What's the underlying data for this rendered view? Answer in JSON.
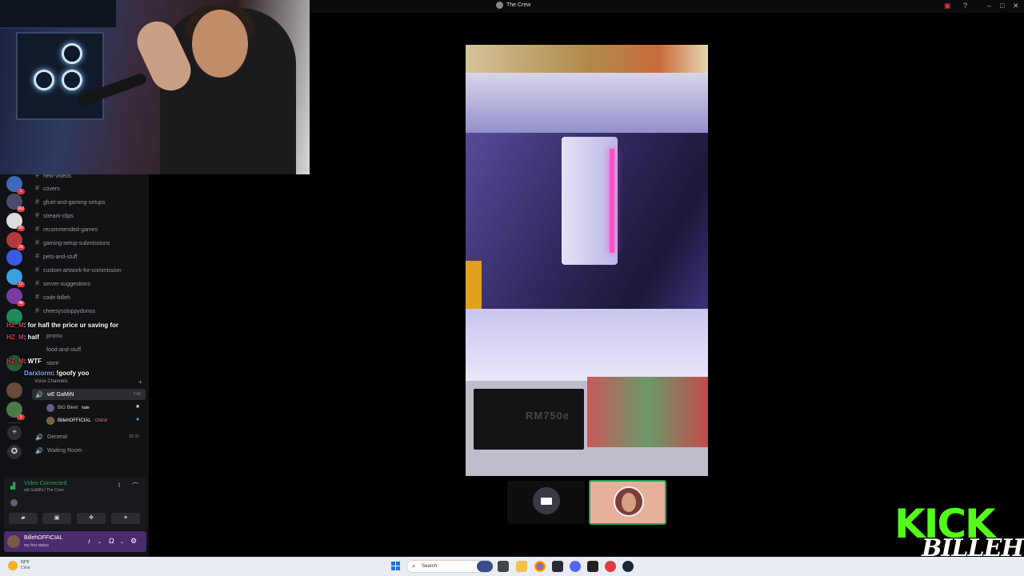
{
  "window": {
    "title": "The Crew"
  },
  "channels": [
    "new-videos",
    "covers",
    "gfuel-and-gaming-setups",
    "stream-clips",
    "recommended-games",
    "gaming-setup-submissions",
    "pets-and-stuff",
    "custom-artwork-for-commission",
    "server-suggestions",
    "code-billeh",
    "cheesyssloppydonos",
    "promo",
    "food-and-stuff",
    "store"
  ],
  "voice": {
    "header": "Voice Channels",
    "channels": [
      {
        "name": "wE GaMiN",
        "timer": "7:40"
      },
      {
        "name": "General",
        "count": "00",
        "limit": "25"
      },
      {
        "name": "Waiting Room"
      }
    ],
    "users": [
      {
        "name": "BiG Bleet",
        "tag": "kate"
      },
      {
        "name": "BillehOFFICIAL",
        "tag": "CREW"
      }
    ]
  },
  "connection": {
    "status": "Video Connected",
    "location": "wE GaMiN / The Crew"
  },
  "user_panel": {
    "name": "BillehOFFICIAL",
    "status": "my first status"
  },
  "server_badges": [
    "1",
    "162",
    "86",
    "28",
    "11",
    "1",
    "48",
    "1"
  ],
  "chat": [
    {
      "user": "HZ_M",
      "text": ": for hafl the price ur saving for"
    },
    {
      "user": "HZ_M",
      "text": ": half"
    },
    {
      "user": "HZ_M",
      "text": ": WTF"
    },
    {
      "user": "Darxtorm",
      "text": ": !goofy yoo"
    }
  ],
  "video": {
    "psu_label": "RM750e"
  },
  "overlay": {
    "brand": "KICK",
    "streamer": "BILLEH"
  },
  "taskbar": {
    "weather_temp": "53°F",
    "weather_cond": "Clear",
    "search_placeholder": "Search"
  },
  "icons": {
    "hash": "#",
    "speaker": "🔊",
    "plus": "+",
    "mic": "🎤",
    "headphones": "🎧",
    "gear": "⚙",
    "hangup": "☎",
    "signal": "📶"
  },
  "colors": {
    "accent_green": "#23a55a",
    "kick_green": "#53fc18",
    "user_panel": "#4a2b6d",
    "chat_user": "#e0384a"
  }
}
